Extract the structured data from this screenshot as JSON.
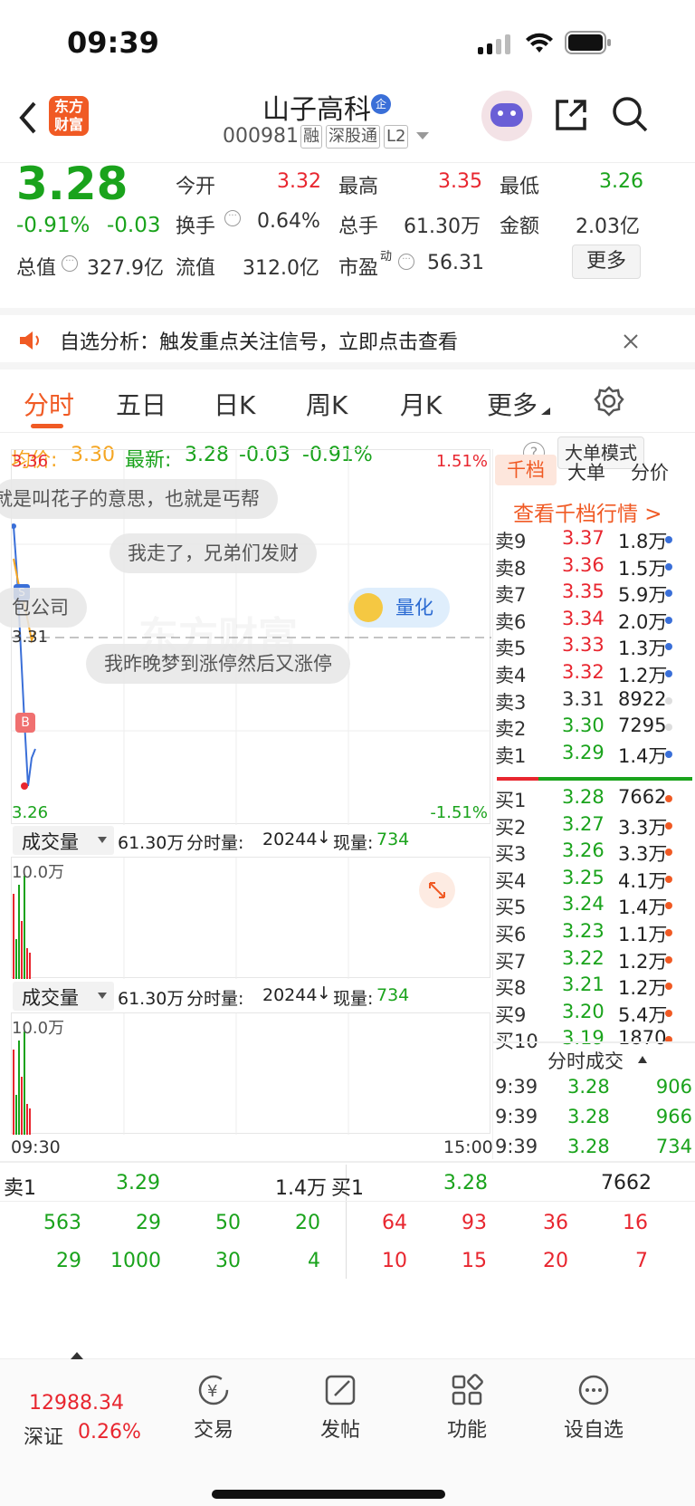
{
  "status_bar": {
    "time": "09:39"
  },
  "header": {
    "logo_text": "东方财富",
    "stock_name": "山子高科",
    "stock_code": "000981",
    "tags": [
      "融",
      "深股通",
      "L2"
    ]
  },
  "quote": {
    "price": "3.28",
    "change_pct": "-0.91%",
    "change": "-0.03",
    "open_label": "今开",
    "open": "3.32",
    "high_label": "最高",
    "high": "3.35",
    "low_label": "最低",
    "low": "3.26",
    "turnover_label": "换手",
    "turnover": "0.64%",
    "volume_label": "总手",
    "volume": "61.30万",
    "amount_label": "金额",
    "amount": "2.03亿",
    "mcap_label": "总值",
    "mcap": "327.9亿",
    "float_label": "流值",
    "float": "312.0亿",
    "pe_label": "市盈",
    "pe_sup": "动",
    "pe": "56.31",
    "more_button": "更多"
  },
  "banner": {
    "text": "自选分析：触发重点关注信号，立即点击查看"
  },
  "tabs": [
    "分时",
    "五日",
    "日K",
    "周K",
    "月K",
    "更多"
  ],
  "avg_line": {
    "avg_label": "均价:",
    "avg": "3.30",
    "latest_label": "最新:",
    "latest": "3.28",
    "change": "-0.03",
    "pct": "-0.91%",
    "mode_button": "大单模式"
  },
  "chart": {
    "top_price": "3.36",
    "top_pct": "1.51%",
    "mid_price": "3.31",
    "bottom_price": "3.26",
    "bottom_pct": "-1.51%",
    "watermark": "东方财富",
    "start_time": "09:30",
    "end_time": "15:00"
  },
  "comments": [
    "就是叫花子的意思，也就是丐帮",
    "我走了，兄弟们发财",
    "包公司",
    "我昨晚梦到涨停然后又涨停"
  ],
  "quant_label": "量化",
  "volume_panels": [
    {
      "selector": "成交量",
      "total": "61.30万",
      "period_label": "分时量:",
      "period": "20244",
      "current_label": "现量:",
      "current": "734",
      "scale": "10.0万"
    },
    {
      "selector": "成交量",
      "total": "61.30万",
      "period_label": "分时量:",
      "period": "20244",
      "current_label": "现量:",
      "current": "734",
      "scale": "10.0万"
    }
  ],
  "orderbook": {
    "tabs": [
      "千档",
      "大单",
      "分价"
    ],
    "link": "查看千档行情 >",
    "asks": [
      {
        "label": "卖9",
        "price": "3.37",
        "vol": "1.8万"
      },
      {
        "label": "卖8",
        "price": "3.36",
        "vol": "1.5万"
      },
      {
        "label": "卖7",
        "price": "3.35",
        "vol": "5.9万"
      },
      {
        "label": "卖6",
        "price": "3.34",
        "vol": "2.0万"
      },
      {
        "label": "卖5",
        "price": "3.33",
        "vol": "1.3万"
      },
      {
        "label": "卖4",
        "price": "3.32",
        "vol": "1.2万"
      },
      {
        "label": "卖3",
        "price": "3.31",
        "vol": "8922"
      },
      {
        "label": "卖2",
        "price": "3.30",
        "vol": "7295"
      },
      {
        "label": "卖1",
        "price": "3.29",
        "vol": "1.4万"
      }
    ],
    "bids": [
      {
        "label": "买1",
        "price": "3.28",
        "vol": "7662"
      },
      {
        "label": "买2",
        "price": "3.27",
        "vol": "3.3万"
      },
      {
        "label": "买3",
        "price": "3.26",
        "vol": "3.3万"
      },
      {
        "label": "买4",
        "price": "3.25",
        "vol": "4.1万"
      },
      {
        "label": "买5",
        "price": "3.24",
        "vol": "1.4万"
      },
      {
        "label": "买6",
        "price": "3.23",
        "vol": "1.1万"
      },
      {
        "label": "买7",
        "price": "3.22",
        "vol": "1.2万"
      },
      {
        "label": "买8",
        "price": "3.21",
        "vol": "1.2万"
      },
      {
        "label": "买9",
        "price": "3.20",
        "vol": "5.4万"
      },
      {
        "label": "买10",
        "price": "3.19",
        "vol": "1870"
      }
    ],
    "ticks_title": "分时成交",
    "ticks": [
      {
        "time": "9:39",
        "price": "3.28",
        "vol": "906"
      },
      {
        "time": "9:39",
        "price": "3.28",
        "vol": "966"
      },
      {
        "time": "9:39",
        "price": "3.28",
        "vol": "734"
      }
    ]
  },
  "queue": {
    "sell_label": "卖1",
    "sell_price": "3.29",
    "sell_vol": "1.4万",
    "buy_label": "买1",
    "buy_price": "3.28",
    "buy_vol": "7662",
    "sell_row1": [
      "563",
      "29",
      "50",
      "20"
    ],
    "sell_row2": [
      "29",
      "1000",
      "30",
      "4"
    ],
    "buy_row1": [
      "64",
      "93",
      "36",
      "16"
    ],
    "buy_row2": [
      "10",
      "15",
      "20",
      "7"
    ]
  },
  "tabbar": {
    "index_value": "12988.34",
    "index_name": "深证",
    "index_pct": "0.26%",
    "items": [
      "交易",
      "发帖",
      "功能",
      "设自选"
    ]
  }
}
